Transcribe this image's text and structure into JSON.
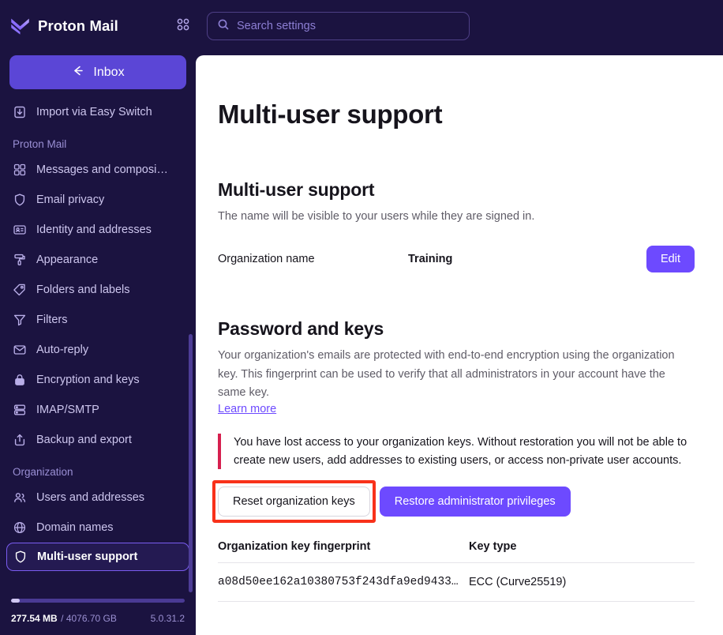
{
  "topbar": {
    "brand_name": "Proton Mail",
    "brand_logo_icon": "proton-mail-logo-icon",
    "apps_icon": "apps-grid-icon",
    "search": {
      "icon": "search-icon",
      "placeholder": "Search settings",
      "value": ""
    }
  },
  "sidebar": {
    "back_button": {
      "label": "Inbox",
      "icon": "arrow-left-icon"
    },
    "top_items": [
      {
        "label": "Import via Easy Switch",
        "icon": "import-icon",
        "selected": false
      }
    ],
    "groups": [
      {
        "title": "Proton Mail",
        "items": [
          {
            "label": "Messages and composi…",
            "icon": "messages-grid-icon",
            "selected": false
          },
          {
            "label": "Email privacy",
            "icon": "shield-icon",
            "selected": false
          },
          {
            "label": "Identity and addresses",
            "icon": "id-card-icon",
            "selected": false
          },
          {
            "label": "Appearance",
            "icon": "paint-roller-icon",
            "selected": false
          },
          {
            "label": "Folders and labels",
            "icon": "tag-icon",
            "selected": false
          },
          {
            "label": "Filters",
            "icon": "filter-icon",
            "selected": false
          },
          {
            "label": "Auto-reply",
            "icon": "envelope-reply-icon",
            "selected": false
          },
          {
            "label": "Encryption and keys",
            "icon": "lock-icon",
            "selected": false
          },
          {
            "label": "IMAP/SMTP",
            "icon": "server-icon",
            "selected": false
          },
          {
            "label": "Backup and export",
            "icon": "export-icon",
            "selected": false
          }
        ]
      },
      {
        "title": "Organization",
        "items": [
          {
            "label": "Users and addresses",
            "icon": "users-icon",
            "selected": false
          },
          {
            "label": "Domain names",
            "icon": "globe-icon",
            "selected": false
          },
          {
            "label": "Multi-user support",
            "icon": "shield-icon",
            "selected": true
          }
        ]
      }
    ],
    "storage": {
      "used": "277.54 MB",
      "separator": "/ 4076.70 GB",
      "percent": 5,
      "version": "5.0.31.2"
    }
  },
  "main": {
    "page_title": "Multi-user support",
    "section_org": {
      "title": "Multi-user support",
      "subtitle": "The name will be visible to your users while they are signed in.",
      "row_label": "Organization name",
      "row_value": "Training",
      "edit_label": "Edit"
    },
    "section_keys": {
      "title": "Password and keys",
      "paragraph": "Your organization's emails are protected with end-to-end encryption using the organization key. This fingerprint can be used to verify that all administrators in your account have the same key.",
      "learn_more": "Learn more",
      "warning": "You have lost access to your organization keys. Without restoration you will not be able to create new users, add addresses to existing users, or access non-private user accounts.",
      "reset_label": "Reset organization keys",
      "restore_label": "Restore administrator privileges",
      "table": {
        "headers": [
          "Organization key fingerprint",
          "Key type"
        ],
        "rows": [
          [
            "a08d50ee162a10380753f243dfa9ed9433…",
            "ECC (Curve25519)"
          ]
        ]
      }
    }
  },
  "colors": {
    "sidebar_bg": "#1b1340",
    "accent_purple": "#6d4aff",
    "inbox_purple": "#5b46d6",
    "warning_red": "#d6204f",
    "annotation_red": "#f8311a"
  }
}
